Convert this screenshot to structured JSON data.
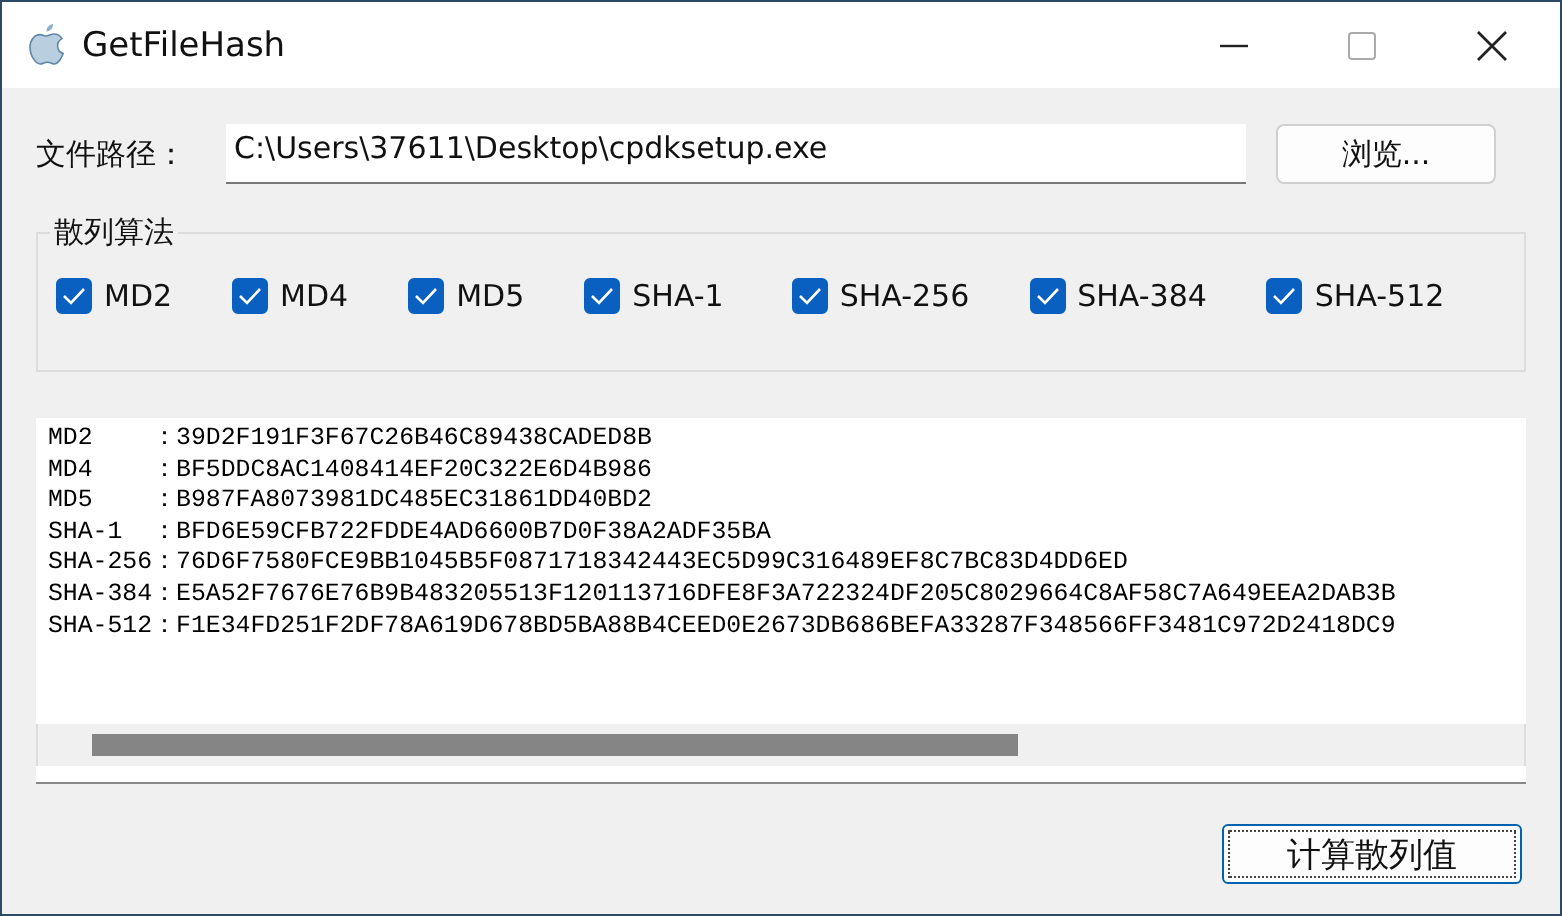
{
  "window": {
    "title": "GetFileHash"
  },
  "path": {
    "label": "文件路径：",
    "value": "C:\\Users\\37611\\Desktop\\cpdksetup.exe",
    "browse_button": "浏览..."
  },
  "algorithms": {
    "title": "散列算法",
    "options": [
      {
        "label": "MD2",
        "checked": true
      },
      {
        "label": "MD4",
        "checked": true
      },
      {
        "label": "MD5",
        "checked": true
      },
      {
        "label": "SHA-1",
        "checked": true
      },
      {
        "label": "SHA-256",
        "checked": true
      },
      {
        "label": "SHA-384",
        "checked": true
      },
      {
        "label": "SHA-512",
        "checked": true
      }
    ]
  },
  "output": {
    "lines": [
      "MD2    ：39D2F191F3F67C26B46C89438CADED8B",
      "MD4    ：BF5DDC8AC1408414EF20C322E6D4B986",
      "MD5    ：B987FA8073981DC485EC31861DD40BD2",
      "SHA-1  ：BFD6E59CFB722FDDE4AD6600B7D0F38A2ADF35BA",
      "SHA-256：76D6F7580FCE9BB1045B5F0871718342443EC5D99C316489EF8C7BC83D4DD6ED",
      "SHA-384：E5A52F7676E76B9B483205513F120113716DFE8F3A722324DF205C8029664C8AF58C7A649EEA2DAB3B",
      "SHA-512：F1E34FD251F2DF78A619D678BD5BA88B4CEED0E2673DB686BEFA33287F348566FF3481C972D2418DC9"
    ]
  },
  "compute_button": "计算散列值"
}
